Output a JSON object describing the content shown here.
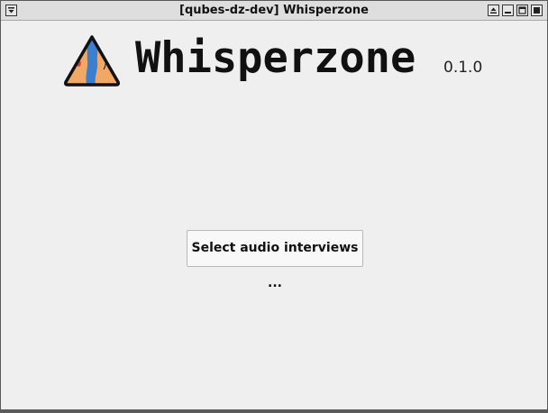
{
  "window": {
    "title": "[qubes-dz-dev] Whisperzone",
    "controls": [
      "window-menu-icon",
      "shade-icon",
      "minimize-icon",
      "maximize-icon",
      "close-icon"
    ]
  },
  "header": {
    "logo_icon": "whisperzone-logo-icon",
    "app_name": "Whisperzone",
    "version": "0.1.0"
  },
  "main": {
    "select_button_label": "Select audio interviews ..."
  },
  "colors": {
    "background": "#efefef",
    "titlebar": "#dedede",
    "logo_orange": "#f2a865",
    "logo_blue": "#3a7fd0",
    "logo_red": "#e03a2a"
  }
}
